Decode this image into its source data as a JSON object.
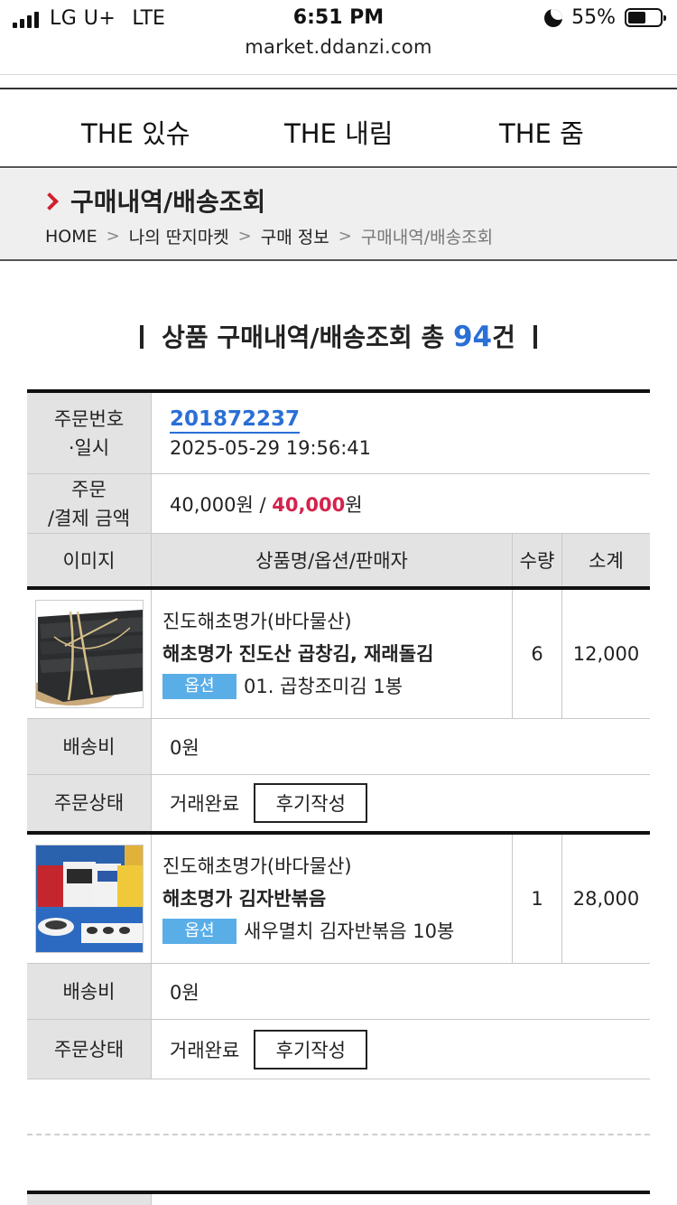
{
  "status_bar": {
    "carrier": "LG U+",
    "network": "LTE",
    "time": "6:51 PM",
    "battery": "55%",
    "battery_level": 0.55
  },
  "browser": {
    "url": "market.ddanzi.com"
  },
  "nav": {
    "items": [
      "THE 있슈",
      "THE 내림",
      "THE 줌"
    ]
  },
  "breadcrumb": {
    "title": "구매내역/배송조회",
    "trail": [
      "HOME",
      "나의 딴지마켓",
      "구매 정보",
      "구매내역/배송조회"
    ]
  },
  "heading": {
    "prefix": "상품 구매내역/배송조회 총 ",
    "count": "94",
    "suffix": "건"
  },
  "order": {
    "labels": {
      "order_no": "주문번호\n·일시",
      "payment": "주문\n/결제 금액",
      "col_image": "이미지",
      "col_name": "상품명/옵션/판매자",
      "col_qty": "수량",
      "col_subtotal": "소계",
      "shipping": "배송비",
      "status": "주문상태",
      "option_badge": "옵션"
    },
    "number": "201872237",
    "datetime": "2025-05-29 19:56:41",
    "order_amount": "40,000원 / ",
    "paid_amount": "40,000",
    "won": "원",
    "items": [
      {
        "seller": "진도해초명가(바다물산)",
        "title": "해초명가 진도산 곱창김, 재래돌김",
        "option": "01. 곱창조미김 1봉",
        "qty": "6",
        "subtotal": "12,000",
        "shipping": "0원",
        "status": "거래완료",
        "review": "후기작성"
      },
      {
        "seller": "진도해초명가(바다물산)",
        "title": "해초명가 김자반볶음",
        "option": "새우멸치 김자반볶음 10봉",
        "qty": "1",
        "subtotal": "28,000",
        "shipping": "0원",
        "status": "거래완료",
        "review": "후기작성"
      }
    ]
  },
  "colors": {
    "accent_blue": "#2a6fd6",
    "price_red": "#d3234c",
    "option_badge": "#5aaee8",
    "chevron_red": "#d0202e"
  }
}
